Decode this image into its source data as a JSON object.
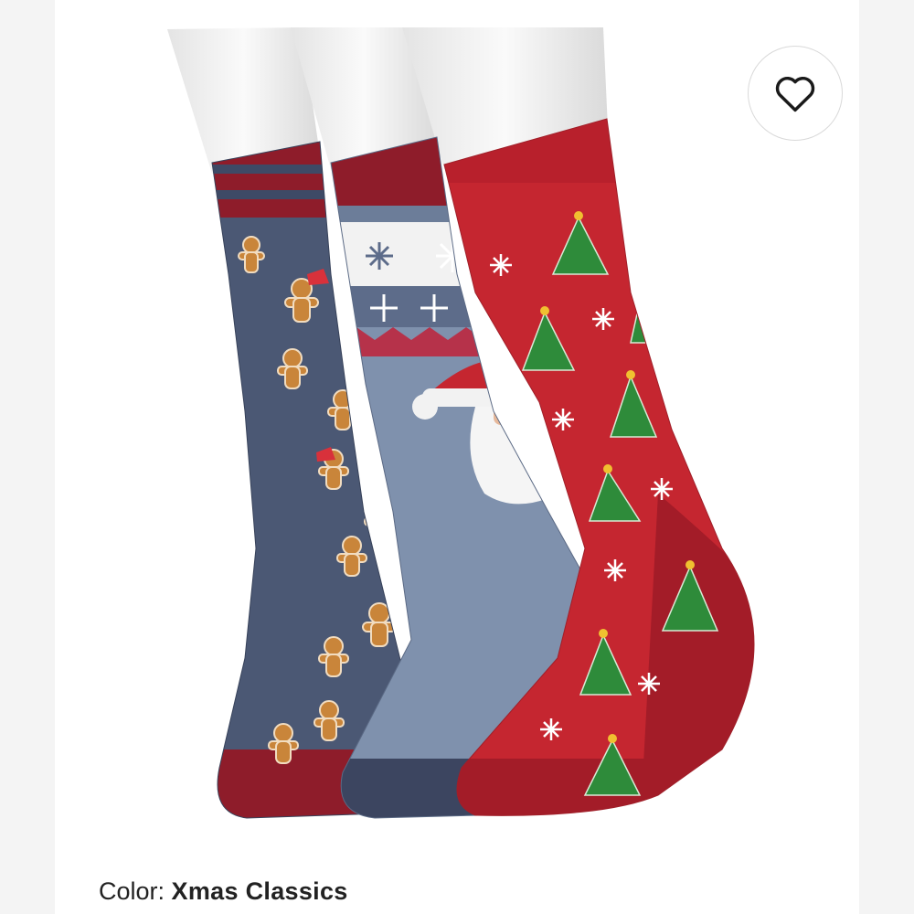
{
  "product": {
    "image_alt": "Three Christmas crew socks: gingerbread, Santa, Christmas trees",
    "color_label": "Color:",
    "color_value": "Xmas Classics"
  },
  "favorite": {
    "icon": "heart-outline-icon",
    "active": false
  },
  "colors": {
    "background": "#ffffff",
    "gutter": "#f4f4f4",
    "navy_sock": "#4b5874",
    "blue_sock": "#7f91ad",
    "red_sock": "#c52630",
    "maroon_trim": "#8e1c2a",
    "gingerbread": "#c9853a",
    "tree_green": "#2e8b3a"
  }
}
